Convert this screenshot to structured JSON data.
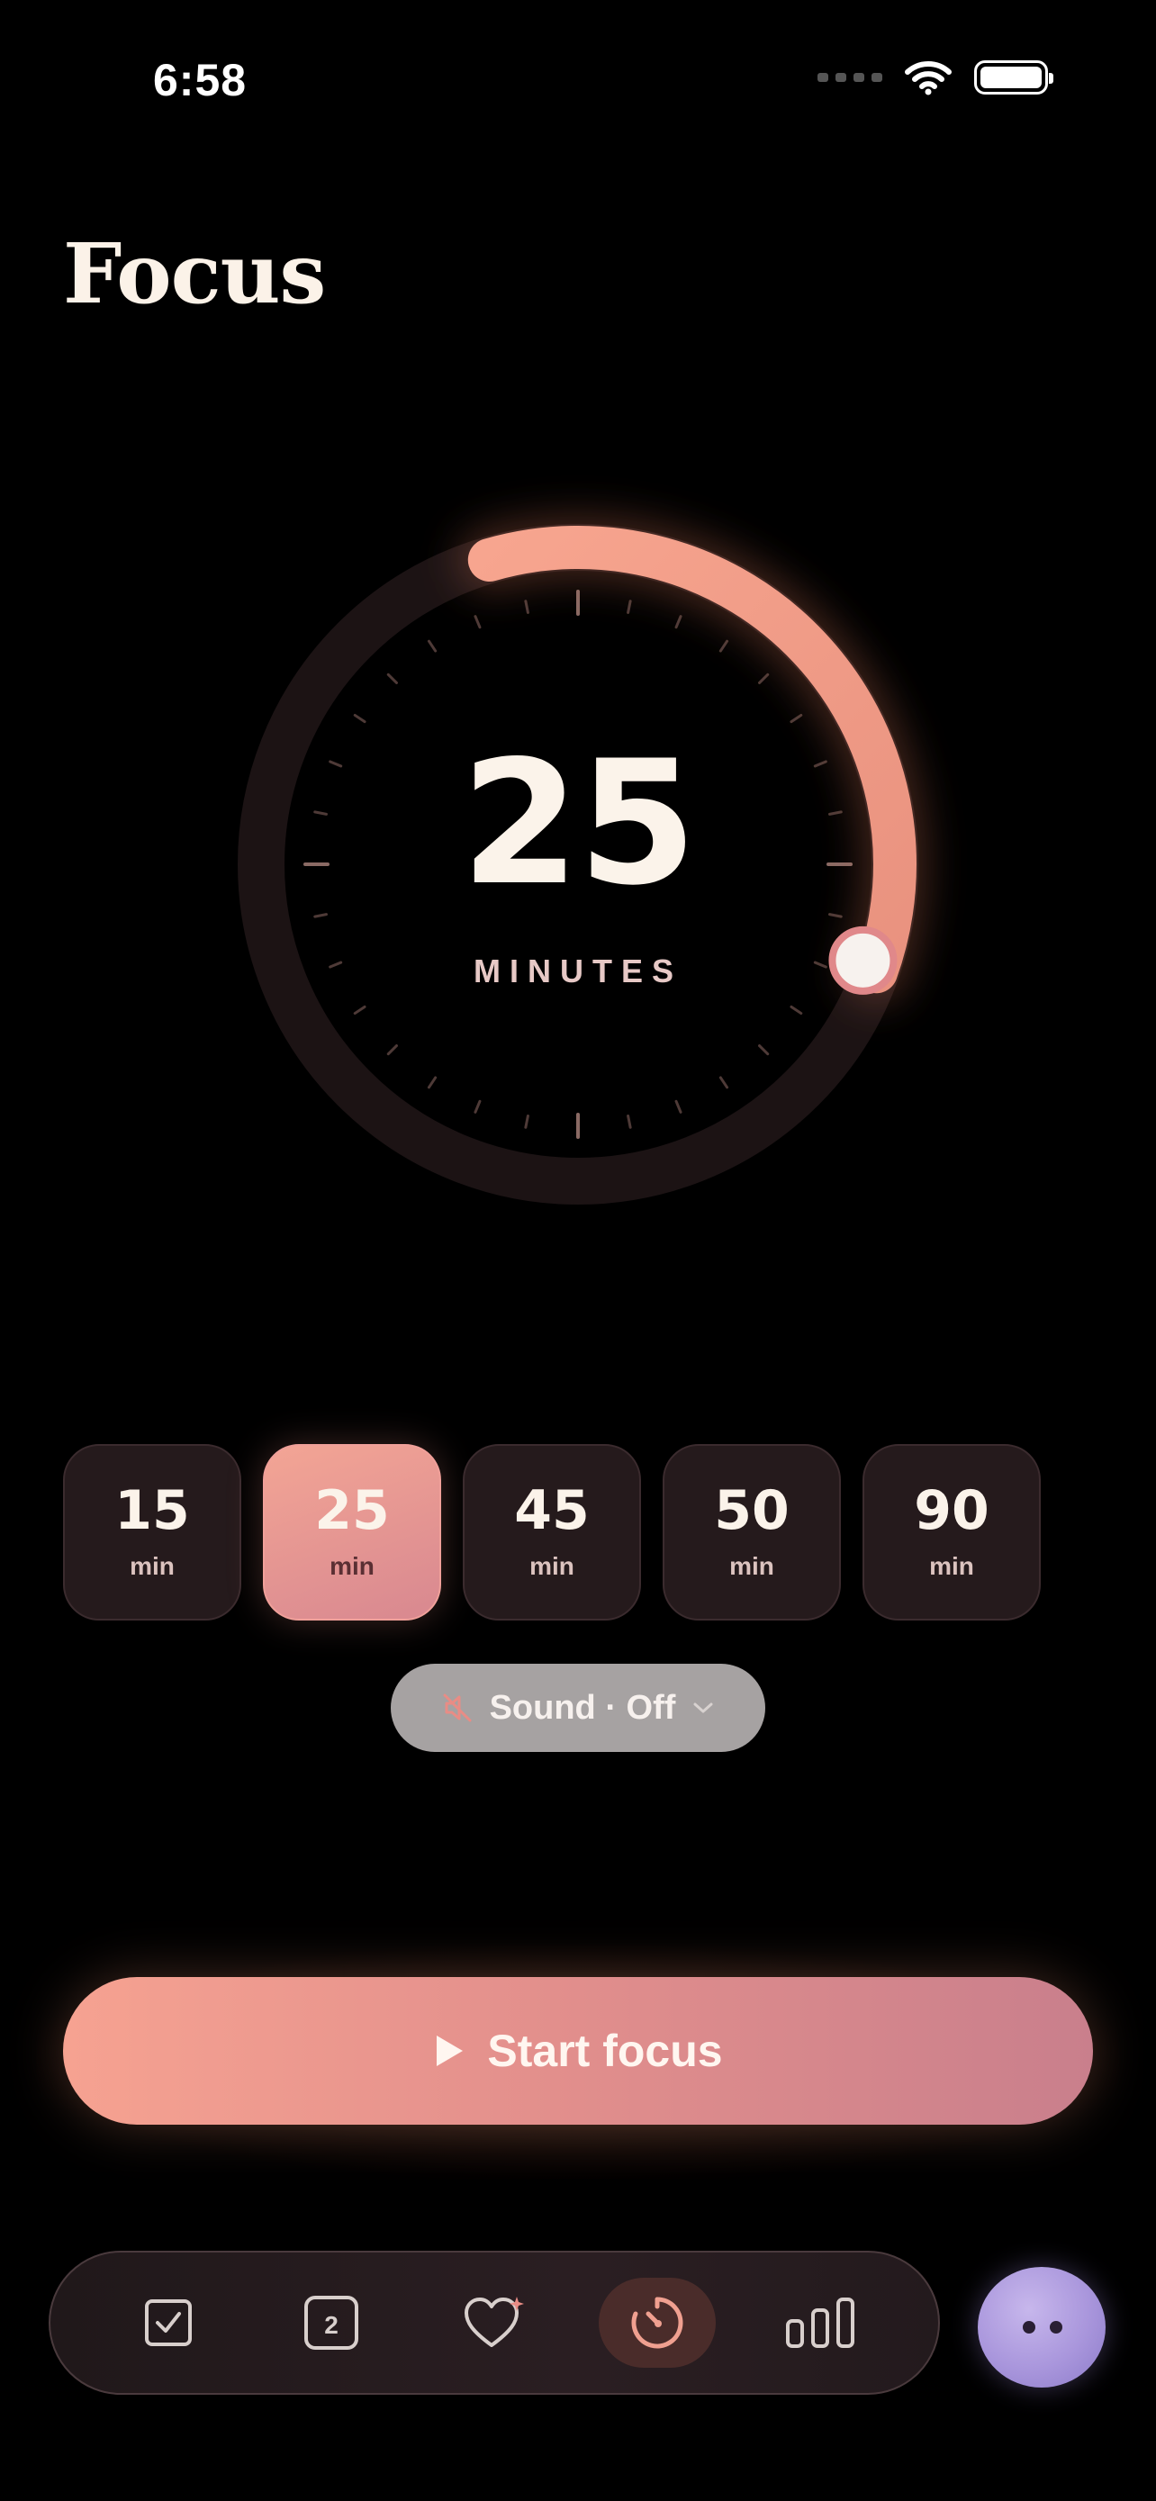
{
  "status_bar": {
    "time": "6:58"
  },
  "header": {
    "title": "Focus"
  },
  "dial": {
    "value": "25",
    "unit": "MINUTES",
    "progress_fraction": 0.35
  },
  "durations": [
    {
      "value": "15",
      "unit": "min",
      "selected": false
    },
    {
      "value": "25",
      "unit": "min",
      "selected": true
    },
    {
      "value": "45",
      "unit": "min",
      "selected": false
    },
    {
      "value": "50",
      "unit": "min",
      "selected": false
    },
    {
      "value": "90",
      "unit": "min",
      "selected": false
    }
  ],
  "sound": {
    "label": "Sound · Off",
    "icon": "speaker-muted-icon"
  },
  "start_button": {
    "label": "Start focus",
    "icon": "play-icon"
  },
  "tabbar": {
    "tabs": [
      {
        "icon": "checkbox-icon",
        "active": false
      },
      {
        "icon": "calendar-day-icon",
        "badge_text": "2",
        "active": false
      },
      {
        "icon": "heart-sparkle-icon",
        "active": false
      },
      {
        "icon": "timer-icon",
        "active": true
      },
      {
        "icon": "bar-chart-icon",
        "active": false
      }
    ]
  },
  "colors": {
    "background": "#000000",
    "accent": "#f6a291",
    "accent_end": "#c97f8c",
    "title": "#fbf2e8",
    "sound_pill": "#a6a2a2",
    "avatar": "#a996dc"
  }
}
